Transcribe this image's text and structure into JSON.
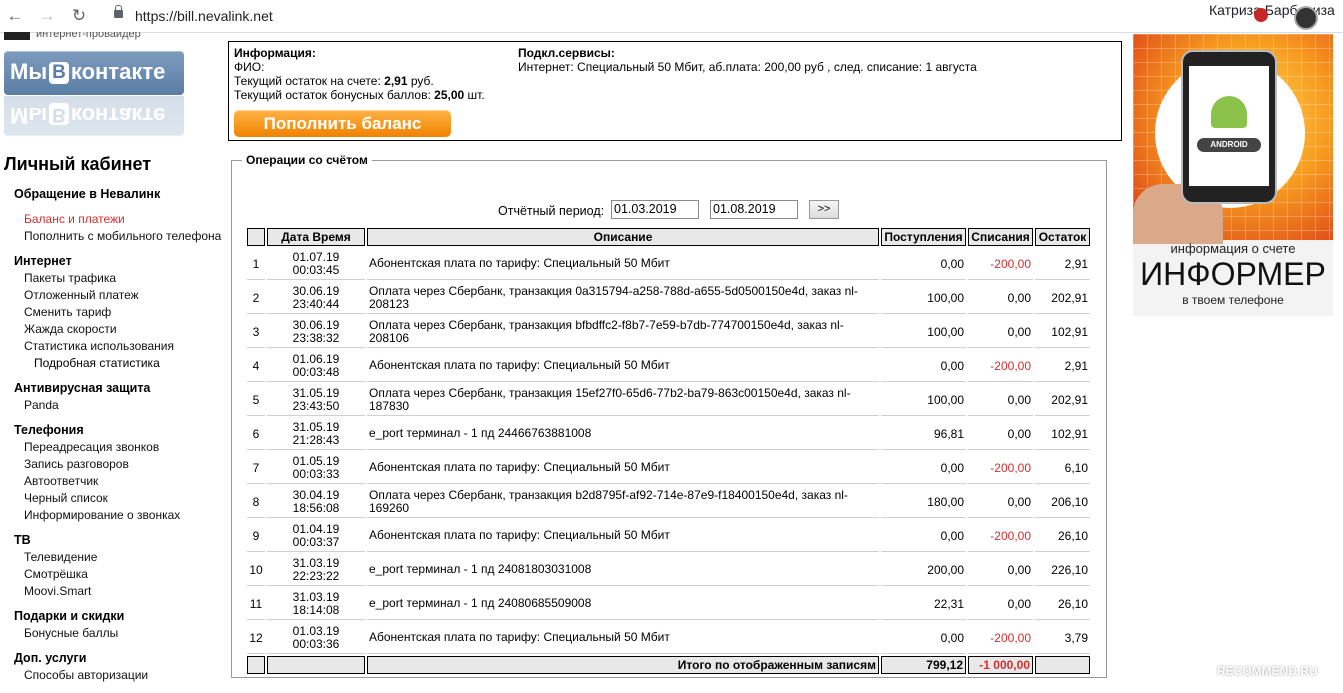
{
  "browser": {
    "url": "https://bill.nevalink.net",
    "profile_name": "Катриза Барбариза"
  },
  "left": {
    "provider_text": "интернет-провайдер",
    "vk_prefix": "Мы",
    "vk_b": "B",
    "vk_suffix": "контакте",
    "cabinet_title": "Личный кабинет",
    "menu": [
      {
        "type": "head",
        "label": "Обращение в Невалинк"
      },
      {
        "type": "spacer"
      },
      {
        "type": "item",
        "label": "Баланс и платежи",
        "active": true
      },
      {
        "type": "item",
        "label": "Пополнить с мобильного телефона"
      },
      {
        "type": "spacer"
      },
      {
        "type": "head",
        "label": "Интернет"
      },
      {
        "type": "item",
        "label": "Пакеты трафика"
      },
      {
        "type": "item",
        "label": "Отложенный платеж"
      },
      {
        "type": "item",
        "label": "Сменить тариф"
      },
      {
        "type": "item",
        "label": "Жажда скорости"
      },
      {
        "type": "item",
        "label": "Статистика использования"
      },
      {
        "type": "sub",
        "label": "Подробная статистика"
      },
      {
        "type": "spacer"
      },
      {
        "type": "head",
        "label": "Антивирусная защита"
      },
      {
        "type": "item",
        "label": "Panda"
      },
      {
        "type": "spacer"
      },
      {
        "type": "head",
        "label": "Телефония"
      },
      {
        "type": "item",
        "label": "Переадресация звонков"
      },
      {
        "type": "item",
        "label": "Запись разговоров"
      },
      {
        "type": "item",
        "label": "Автоответчик"
      },
      {
        "type": "item",
        "label": "Черный список"
      },
      {
        "type": "item",
        "label": "Информирование о звонках"
      },
      {
        "type": "spacer"
      },
      {
        "type": "head",
        "label": "ТВ"
      },
      {
        "type": "item",
        "label": "Телевидение"
      },
      {
        "type": "item",
        "label": "Смотрёшка"
      },
      {
        "type": "item",
        "label": "Moovi.Smart"
      },
      {
        "type": "spacer"
      },
      {
        "type": "head",
        "label": "Подарки и скидки"
      },
      {
        "type": "item",
        "label": "Бонусные баллы"
      },
      {
        "type": "spacer"
      },
      {
        "type": "head",
        "label": "Доп. услуги"
      },
      {
        "type": "item",
        "label": "Способы авторизации"
      }
    ]
  },
  "info": {
    "heading": "Информация:",
    "fio_label": "ФИО:",
    "balance_label": "Текущий остаток на счете:",
    "balance_value": "2,91",
    "balance_unit": "руб.",
    "bonus_label": "Текущий остаток бонусных баллов:",
    "bonus_value": "25,00",
    "bonus_unit": "шт.",
    "services_heading": "Подкл.сервисы:",
    "services_text": "Интернет: Специальный 50 Мбит, аб.плата: 200,00 руб , след. списание: 1 августа",
    "pay_button": "Пополнить баланс"
  },
  "ops": {
    "legend": "Операции со счётом",
    "period_label": "Отчётный период:",
    "date_from": "01.03.2019",
    "date_to": "01.08.2019",
    "go_button": ">>",
    "columns": [
      "",
      "Дата Время",
      "Описание",
      "Поступления",
      "Списания",
      "Остаток"
    ],
    "rows": [
      {
        "n": "1",
        "date": "01.07.19",
        "time": "00:03:45",
        "desc": "Абонентская плата по тарифу: Специальный 50 Мбит",
        "in": "0,00",
        "out": "-200,00",
        "bal": "2,91",
        "neg": true
      },
      {
        "n": "2",
        "date": "30.06.19",
        "time": "23:40:44",
        "desc": "Оплата через Сбербанк, транзакция 0a315794-a258-788d-a655-5d0500150e4d, заказ nl-208123",
        "in": "100,00",
        "out": "0,00",
        "bal": "202,91",
        "neg": false
      },
      {
        "n": "3",
        "date": "30.06.19",
        "time": "23:38:32",
        "desc": "Оплата через Сбербанк, транзакция bfbdffc2-f8b7-7e59-b7db-774700150e4d, заказ nl-208106",
        "in": "100,00",
        "out": "0,00",
        "bal": "102,91",
        "neg": false
      },
      {
        "n": "4",
        "date": "01.06.19",
        "time": "00:03:48",
        "desc": "Абонентская плата по тарифу: Специальный 50 Мбит",
        "in": "0,00",
        "out": "-200,00",
        "bal": "2,91",
        "neg": true
      },
      {
        "n": "5",
        "date": "31.05.19",
        "time": "23:43:50",
        "desc": "Оплата через Сбербанк, транзакция 15ef27f0-65d6-77b2-ba79-863c00150e4d, заказ nl-187830",
        "in": "100,00",
        "out": "0,00",
        "bal": "202,91",
        "neg": false
      },
      {
        "n": "6",
        "date": "31.05.19",
        "time": "21:28:43",
        "desc": "e_port терминал - 1 пд 24466763881008",
        "in": "96,81",
        "out": "0,00",
        "bal": "102,91",
        "neg": false
      },
      {
        "n": "7",
        "date": "01.05.19",
        "time": "00:03:33",
        "desc": "Абонентская плата по тарифу: Специальный 50 Мбит",
        "in": "0,00",
        "out": "-200,00",
        "bal": "6,10",
        "neg": true
      },
      {
        "n": "8",
        "date": "30.04.19",
        "time": "18:56:08",
        "desc": "Оплата через Сбербанк, транзакция b2d8795f-af92-714e-87e9-f18400150e4d, заказ nl-169260",
        "in": "180,00",
        "out": "0,00",
        "bal": "206,10",
        "neg": false
      },
      {
        "n": "9",
        "date": "01.04.19",
        "time": "00:03:37",
        "desc": "Абонентская плата по тарифу: Специальный 50 Мбит",
        "in": "0,00",
        "out": "-200,00",
        "bal": "26,10",
        "neg": true
      },
      {
        "n": "10",
        "date": "31.03.19",
        "time": "22:23:22",
        "desc": "e_port терминал - 1 пд 24081803031008",
        "in": "200,00",
        "out": "0,00",
        "bal": "226,10",
        "neg": false
      },
      {
        "n": "11",
        "date": "31.03.19",
        "time": "18:14:08",
        "desc": "e_port терминал - 1 пд 24080685509008",
        "in": "22,31",
        "out": "0,00",
        "bal": "26,10",
        "neg": false
      },
      {
        "n": "12",
        "date": "01.03.19",
        "time": "00:03:36",
        "desc": "Абонентская плата по тарифу: Специальный 50 Мбит",
        "in": "0,00",
        "out": "-200,00",
        "bal": "3,79",
        "neg": true
      }
    ],
    "total_label": "Итого по отображенным записям",
    "total_in": "799,12",
    "total_out": "-1 000,00"
  },
  "ad": {
    "android_label": "ANDROID",
    "line1": "информация о счете",
    "line2": "ИНФОРМЕР",
    "line3": "в твоем телефоне"
  },
  "watermark": "RECOMMEND.RU",
  "colors": {
    "negative": "#d32f2f",
    "accent_button": "#f08200",
    "vk": "#5b7ea6"
  }
}
